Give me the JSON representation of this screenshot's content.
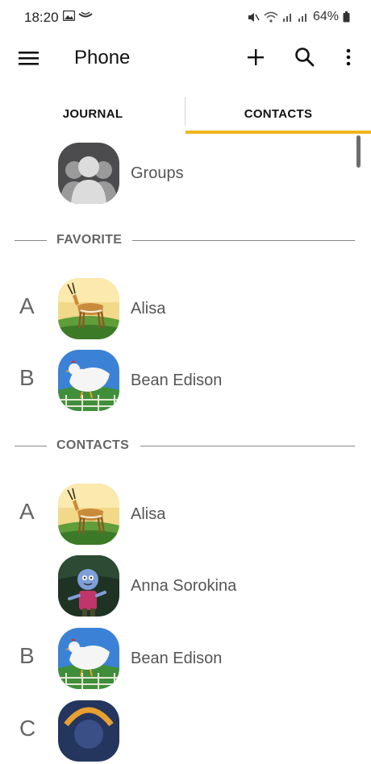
{
  "status": {
    "time": "18:20",
    "battery": "64%"
  },
  "app_bar": {
    "title": "Phone"
  },
  "tabs": [
    {
      "label": "JOURNAL",
      "selected": false
    },
    {
      "label": "CONTACTS",
      "selected": true
    }
  ],
  "accent_color": "#f0b41c",
  "groups": {
    "label": "Groups"
  },
  "favorites": {
    "header": "FAVORITE",
    "items": [
      {
        "letter": "A",
        "name": "Alisa",
        "avatar": "gazelle-avatar"
      },
      {
        "letter": "B",
        "name": "Bean Edison",
        "avatar": "chicken-avatar"
      }
    ]
  },
  "contacts": {
    "header": "CONTACTS",
    "items": [
      {
        "letter": "A",
        "name": "Alisa",
        "avatar": "gazelle-avatar"
      },
      {
        "letter": "",
        "name": "Anna Sorokina",
        "avatar": "zombie-avatar"
      },
      {
        "letter": "B",
        "name": "Bean Edison",
        "avatar": "chicken-avatar"
      },
      {
        "letter": "C",
        "name": "",
        "avatar": "partial-avatar"
      }
    ]
  }
}
